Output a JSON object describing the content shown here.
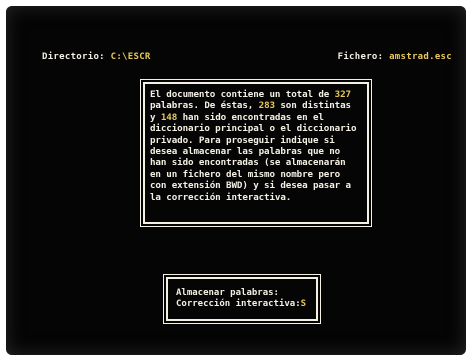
{
  "header": {
    "directory_label": "Directorio:",
    "directory_value": "C:\\ESCR",
    "file_label": "Fichero:",
    "file_value": "amstrad.esc"
  },
  "message": {
    "line1_pre": "El documento contiene un total de  ",
    "total_words": "327",
    "line2_pre": "palabras.  De éstas,  ",
    "distinct_words": "283",
    "line2_post": " son distintas",
    "line3_pre": "y  ",
    "found_words": "148",
    "line3_post": "  han sido encontradas en el",
    "line4": "diccionario principal o el diccionario",
    "line5": "privado.  Para proseguir indique si",
    "line6": "desea almacenar las palabras que no",
    "line7": "han sido encontradas (se almacenarán",
    "line8": "en un fichero del mismo nombre pero",
    "line9": "con extensión BWD) y si desea pasar a",
    "line10": "la corrección interactiva."
  },
  "dialog": {
    "option1_label": "Almacenar palabras:",
    "option2_label": "Corrección interactiva:",
    "cursor_value": "S"
  },
  "colors": {
    "text": "#f4f0e4",
    "highlight": "#e8c95a",
    "background": "#050505"
  }
}
